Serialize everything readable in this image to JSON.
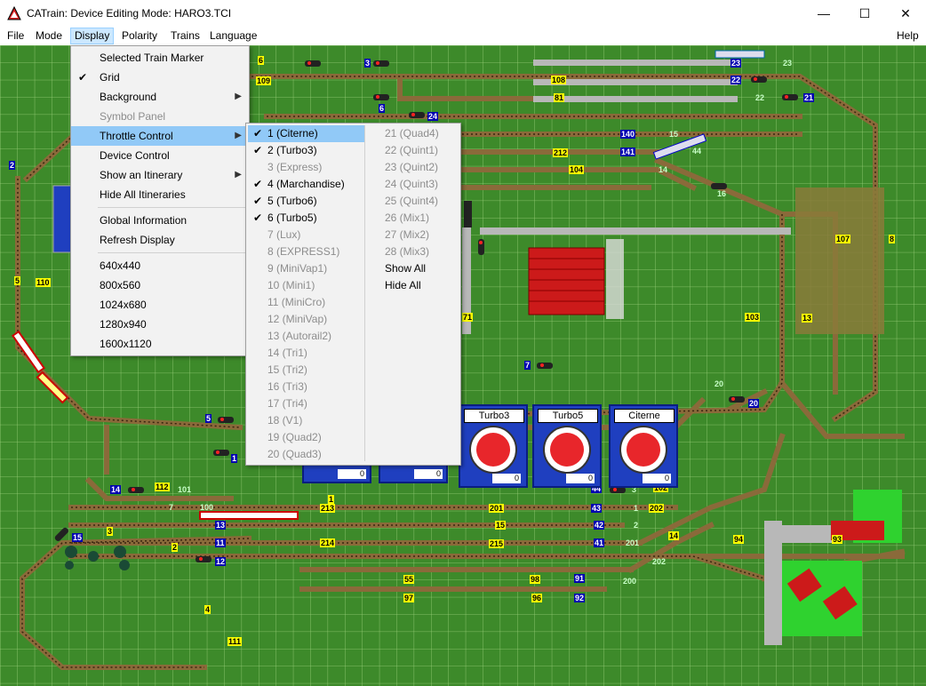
{
  "window": {
    "title": "CATrain: Device Editing Mode: HARO3.TCI",
    "minimize": "—",
    "maximize": "☐",
    "close": "✕"
  },
  "menubar": [
    "File",
    "Mode",
    "Display",
    "Polarity",
    "Trains",
    "Language",
    "Help"
  ],
  "display_menu": {
    "items": [
      {
        "label": "Selected Train Marker",
        "checked": false,
        "disabled": false,
        "submenu": false
      },
      {
        "label": "Grid",
        "checked": true,
        "disabled": false,
        "submenu": false
      },
      {
        "label": "Background",
        "checked": false,
        "disabled": false,
        "submenu": true
      },
      {
        "label": "Symbol Panel",
        "checked": false,
        "disabled": true,
        "submenu": false
      },
      {
        "label": "Throttle Control",
        "checked": false,
        "disabled": false,
        "submenu": true,
        "highlight": true
      },
      {
        "label": "Device Control",
        "checked": false,
        "disabled": false,
        "submenu": false
      },
      {
        "label": "Show an Itinerary",
        "checked": false,
        "disabled": false,
        "submenu": true
      },
      {
        "label": "Hide All Itineraries",
        "checked": false,
        "disabled": false,
        "submenu": false
      },
      {
        "label": "Global Information",
        "checked": false,
        "disabled": false,
        "submenu": false
      },
      {
        "label": "Refresh Display",
        "checked": false,
        "disabled": false,
        "submenu": false
      },
      {
        "label": "640x440",
        "checked": false,
        "disabled": false,
        "submenu": false
      },
      {
        "label": "800x560",
        "checked": false,
        "disabled": false,
        "submenu": false
      },
      {
        "label": "1024x680",
        "checked": false,
        "disabled": false,
        "submenu": false
      },
      {
        "label": "1280x940",
        "checked": false,
        "disabled": false,
        "submenu": false
      },
      {
        "label": "1600x1120",
        "checked": false,
        "disabled": false,
        "submenu": false
      }
    ]
  },
  "throttle_submenu": {
    "col1": [
      {
        "label": "1 (Citerne)",
        "checked": true,
        "disabled": false,
        "highlight": true
      },
      {
        "label": "2 (Turbo3)",
        "checked": true,
        "disabled": false
      },
      {
        "label": "3 (Express)",
        "checked": false,
        "disabled": true
      },
      {
        "label": "4 (Marchandise)",
        "checked": true,
        "disabled": false
      },
      {
        "label": "5 (Turbo6)",
        "checked": true,
        "disabled": false
      },
      {
        "label": "6 (Turbo5)",
        "checked": true,
        "disabled": false
      },
      {
        "label": "7 (Lux)",
        "checked": false,
        "disabled": true
      },
      {
        "label": "8 (EXPRESS1)",
        "checked": false,
        "disabled": true
      },
      {
        "label": "9 (MiniVap1)",
        "checked": false,
        "disabled": true
      },
      {
        "label": "10 (Mini1)",
        "checked": false,
        "disabled": true
      },
      {
        "label": "11 (MiniCro)",
        "checked": false,
        "disabled": true
      },
      {
        "label": "12 (MiniVap)",
        "checked": false,
        "disabled": true
      },
      {
        "label": "13 (Autorail2)",
        "checked": false,
        "disabled": true
      },
      {
        "label": "14 (Tri1)",
        "checked": false,
        "disabled": true
      },
      {
        "label": "15 (Tri2)",
        "checked": false,
        "disabled": true
      },
      {
        "label": "16 (Tri3)",
        "checked": false,
        "disabled": true
      },
      {
        "label": "17 (Tri4)",
        "checked": false,
        "disabled": true
      },
      {
        "label": "18 (V1)",
        "checked": false,
        "disabled": true
      },
      {
        "label": "19 (Quad2)",
        "checked": false,
        "disabled": true
      },
      {
        "label": "20 (Quad3)",
        "checked": false,
        "disabled": true
      }
    ],
    "col2": [
      {
        "label": "21 (Quad4)",
        "disabled": true
      },
      {
        "label": "22 (Quint1)",
        "disabled": true
      },
      {
        "label": "23 (Quint2)",
        "disabled": true
      },
      {
        "label": "24 (Quint3)",
        "disabled": true
      },
      {
        "label": "25 (Quint4)",
        "disabled": true
      },
      {
        "label": "26 (Mix1)",
        "disabled": true
      },
      {
        "label": "27 (Mix2)",
        "disabled": true
      },
      {
        "label": "28 (Mix3)",
        "disabled": true
      },
      {
        "label": "Show All",
        "disabled": false
      },
      {
        "label": "Hide All",
        "disabled": false
      }
    ]
  },
  "throttles": [
    {
      "name": "Turbo3",
      "value": "0"
    },
    {
      "name": "Turbo5",
      "value": "0"
    },
    {
      "name": "Citerne",
      "value": "0"
    }
  ],
  "track_numbers": {
    "yellow": [
      "6",
      "109",
      "108",
      "81",
      "212",
      "104",
      "110",
      "5",
      "71",
      "103",
      "107",
      "8",
      "13",
      "112",
      "213",
      "201",
      "15",
      "214",
      "215",
      "102",
      "4",
      "55",
      "97",
      "98",
      "96",
      "94",
      "93",
      "111",
      "1",
      "3",
      "2",
      "201"
    ],
    "blue": [
      "3",
      "23",
      "22",
      "21",
      "6",
      "24",
      "140",
      "141",
      "2",
      "7",
      "5",
      "1",
      "14",
      "13",
      "11",
      "12",
      "15",
      "43",
      "42",
      "41",
      "44",
      "91",
      "92"
    ],
    "green": [
      "23",
      "22",
      "15",
      "44",
      "14",
      "16",
      "20",
      "20",
      "3",
      "2",
      "1",
      "14",
      "202",
      "200",
      "201",
      "202",
      "100",
      "101",
      "7"
    ]
  },
  "colors": {
    "grass": "#3d8a2a",
    "menu_highlight": "#91c9f7",
    "throttle_blue": "#1f3fbf",
    "dial_red": "#e8262b"
  }
}
